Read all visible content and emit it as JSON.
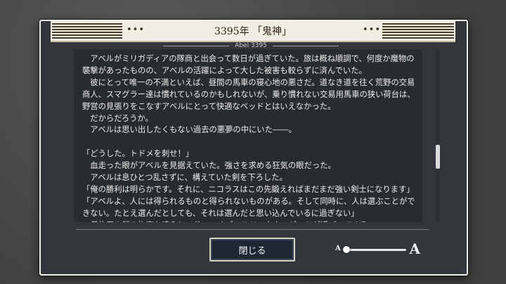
{
  "header": {
    "title": "3395年 「鬼神」",
    "dots_left": "•••",
    "dots_right": "•••",
    "author": "Abel 3395"
  },
  "story": {
    "paragraphs": [
      "　アベルがミリガディアの隊商と出会って数日が過ぎていた。旅は概ね順調で、何度か魔物の",
      "襲撃があったものの、アベルの活躍によって大した被害も較らずに済んでいた。",
      "　彼にとって唯一の不満といえば、昼間の馬車の寝心地の悪さだ。道なき道を往く荒野の交易",
      "商人、スマグラー達は慣れているのかもしれないが、乗り慣れない交易用馬車の狭い荷台は、",
      "野営の見張りをこなすアベルにとって快適なベッドとはいえなかった。",
      "　だからだろうか。",
      "　アベルは思い出したくもない過去の悪夢の中にいた――。",
      "",
      "「どうした。トドメを刺せ！」",
      "　血走った眼がアベルを見据えていた。強さを求める狂気の眼だった。",
      "　アベルは息ひとつ乱さずに、構えていた剣を下ろした。",
      "「俺の勝利は明らかです。それに、ニコラスはこの先鍛えればまだまだ強い剣士になります」",
      "「アベルよ、人には得られるものと得られないものがある。そして同時に、人は選ぶことがで",
      "きない。たとえ選んだとしても、それは選んだと思い込んでいるに過ぎない」",
      "　儀礼用の鎧の拘束を鳴らし、父――オズワルド・タウンゼンドが近づいてくる。"
    ]
  },
  "footer": {
    "close_label": "閉じる",
    "font_small_label": "A",
    "font_large_label": "A",
    "font_size_level": 0.0
  }
}
